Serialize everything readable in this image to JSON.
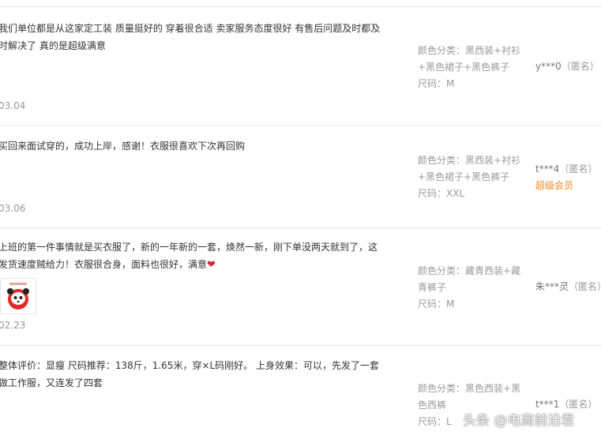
{
  "reviews": [
    {
      "content": "我们单位都是从这家定工装 质量挺好的 穿着很合适 卖家服务态度很好 有售后问题及时都及时解决了 真的是超级满意",
      "date": "03.04",
      "sku_color_label": "颜色分类：",
      "sku_color": "黑西装+衬衫+黑色裙子+黑色裤子",
      "sku_size_label": "尺码：",
      "sku_size": "M",
      "nickname": "y***0",
      "anon": "（匿名）",
      "vip": ""
    },
    {
      "content": "买回来面试穿的，成功上岸，感谢！衣服很喜欢下次再回购",
      "date": "03.06",
      "sku_color_label": "颜色分类：",
      "sku_color": "黑西装+衬衫+黑色裙子+黑色裤子",
      "sku_size_label": "尺码：",
      "sku_size": "XXL",
      "nickname": "t***4",
      "anon": "（匿名）",
      "vip": "超级会员"
    },
    {
      "content": "上班的第一件事情就是买衣服了，新的一年新的一套，焕然一新，刚下单没两天就到了，这发货速度贼给力！衣服很合身，面料也很好，满意",
      "date": "02.23",
      "sku_color_label": "颜色分类：",
      "sku_color": "藏青西装+藏青裤子",
      "sku_size_label": "尺码：",
      "sku_size": "M",
      "nickname": "朱***灵",
      "anon": "（匿名）",
      "vip": ""
    },
    {
      "content": "整体评价：显瘦 尺码推荐：138斤，1.65米，穿×L码刚好。 上身效果：可以，先发了一套做工作服，又连发了四套",
      "date": "",
      "sku_color_label": "颜色分类：",
      "sku_color": "黑色西装+黑色西裤",
      "sku_size_label": "尺码：",
      "sku_size": "L",
      "nickname": "t***1",
      "anon": "（匿名）",
      "vip": ""
    }
  ],
  "watermark": "头条 @电商前沿君",
  "icons": {
    "heart": "heart-icon",
    "thumb": "photo-thumbnail"
  },
  "colors": {
    "vip": "#f08a24",
    "heart": "#d9232e"
  }
}
